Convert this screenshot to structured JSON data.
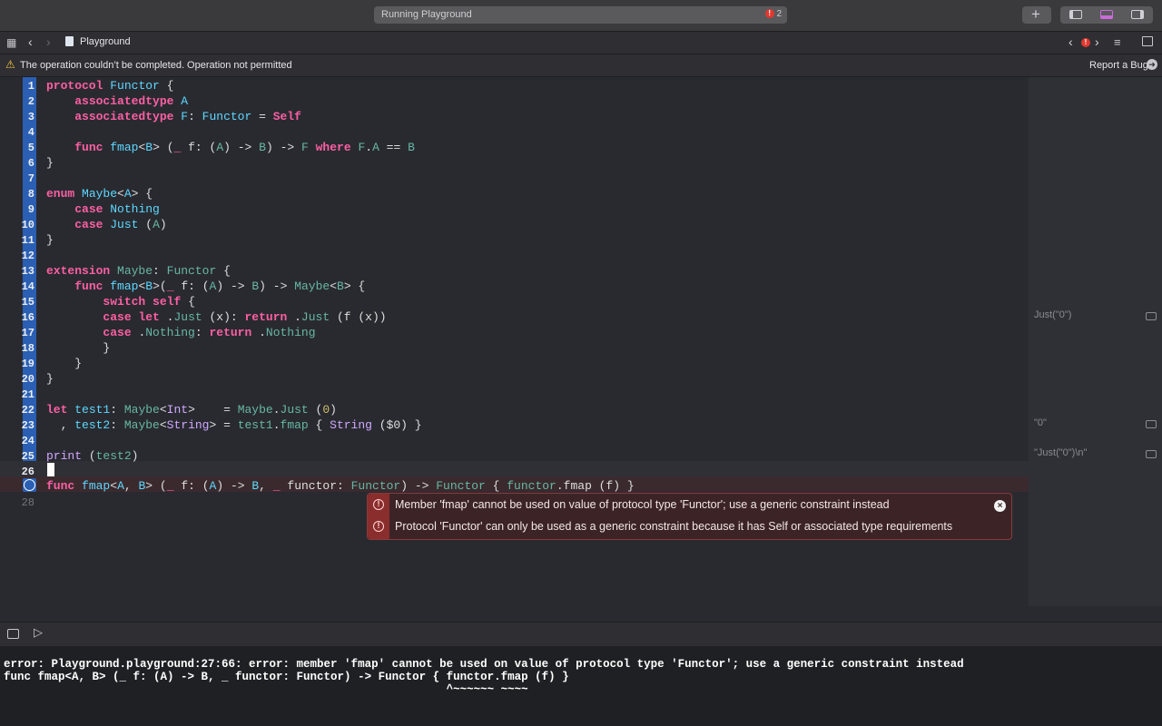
{
  "toolbar": {
    "activity_text": "Running Playground",
    "error_count": "2",
    "add_label": "+"
  },
  "pathbar": {
    "file_name": "Playground"
  },
  "warning": {
    "message": "The operation couldn’t be completed. Operation not permitted",
    "report_label": "Report a Bug"
  },
  "editor": {
    "line_numbers": [
      "1",
      "2",
      "3",
      "4",
      "5",
      "6",
      "7",
      "8",
      "9",
      "10",
      "11",
      "12",
      "13",
      "14",
      "15",
      "16",
      "17",
      "18",
      "19",
      "20",
      "21",
      "22",
      "23",
      "24",
      "25",
      "26",
      "27",
      "28"
    ]
  },
  "results": {
    "line16": "Just(\"0\")",
    "line23": "\"0\"",
    "line25": "\"Just(\"0\")\\n\""
  },
  "errors": {
    "message1": "Member 'fmap' cannot be used on value of protocol type 'Functor'; use a generic constraint instead",
    "message2": "Protocol 'Functor' can only be used as a generic constraint because it has Self or associated type requirements"
  },
  "console": {
    "line1": "error: Playground.playground:27:66: error: member 'fmap' cannot be used on value of protocol type 'Functor'; use a generic constraint instead",
    "line2": "func fmap<A, B> (_ f: (A) -> B, _ functor: Functor) -> Functor { functor.fmap (f) }",
    "line3": "                                                                 ^~~~~~~ ~~~~"
  },
  "colors": {
    "keyword": "#fc5fa3",
    "type": "#5dd8ff",
    "plain": "#dfdfe0",
    "error": "#e0382f",
    "gutter": "#2a5fb3"
  }
}
